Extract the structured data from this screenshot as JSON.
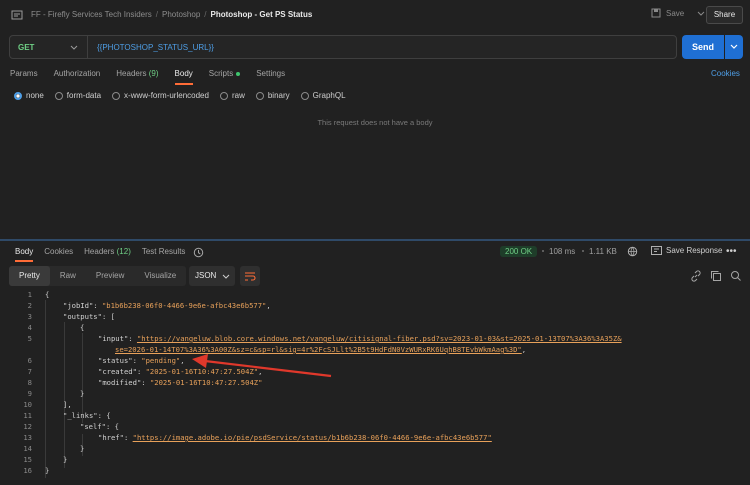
{
  "header": {
    "breadcrumb": [
      "FF - Firefly Services Tech Insiders",
      "Photoshop"
    ],
    "title": "Photoshop - Get PS Status",
    "save_label": "Save",
    "share_label": "Share"
  },
  "request": {
    "method": "GET",
    "url": "{{PHOTOSHOP_STATUS_URL}}",
    "send_label": "Send",
    "tabs": [
      "Params",
      "Authorization",
      "Headers",
      "Body",
      "Scripts",
      "Settings"
    ],
    "headers_count": "(9)",
    "cookies_label": "Cookies",
    "body_types": [
      "none",
      "form-data",
      "x-www-form-urlencoded",
      "raw",
      "binary",
      "GraphQL"
    ],
    "empty_message": "This request does not have a body"
  },
  "response": {
    "tabs": [
      "Body",
      "Cookies",
      "Headers",
      "Test Results"
    ],
    "headers_count": "(12)",
    "status": "200 OK",
    "time": "108 ms",
    "size": "1.11 KB",
    "save_response_label": "Save Response",
    "views": [
      "Pretty",
      "Raw",
      "Preview",
      "Visualize"
    ],
    "format": "JSON",
    "lines": [
      {
        "n": "1",
        "text": "{"
      },
      {
        "n": "2",
        "key": "\"jobId\"",
        "val": "\"b1b6b238-06f0-4466-9e6e-afbc43e6b577\"",
        "tail": ","
      },
      {
        "n": "3",
        "key": "\"outputs\"",
        "tail": "["
      },
      {
        "n": "4",
        "text": "{"
      },
      {
        "n": "5",
        "key": "\"input\"",
        "val": "\"https://vangeluw.blob.core.windows.net/vangeluw/citisignal-fiber.psd?sv=2023-01-03&st=2025-01-13T07%3A36%3A35Z&",
        "val2": "se=2026-01-14T07%3A36%3A00Z&sz=c&sp=rl&sig=4r%2FcSJLlt%2B5t9HdFdN0VzWURxRK6UqhB8TEvbWkmAag%3D\"",
        "tail": ","
      },
      {
        "n": "6",
        "key": "\"status\"",
        "val": "\"pending\"",
        "tail": ","
      },
      {
        "n": "7",
        "key": "\"created\"",
        "val": "\"2025-01-16T10:47:27.504Z\"",
        "tail": ","
      },
      {
        "n": "8",
        "key": "\"modified\"",
        "val": "\"2025-01-16T10:47:27.504Z\""
      },
      {
        "n": "9",
        "text": "}"
      },
      {
        "n": "10",
        "text": "],"
      },
      {
        "n": "11",
        "key": "\"_links\"",
        "tail": "{"
      },
      {
        "n": "12",
        "key": "\"self\"",
        "tail": "{"
      },
      {
        "n": "13",
        "key": "\"href\"",
        "val": "\"https://image.adobe.io/pie/psdService/status/b1b6b238-06f0-4466-9e6e-afbc43e6b577\""
      },
      {
        "n": "14",
        "text": "}"
      },
      {
        "n": "15",
        "text": "}"
      },
      {
        "n": "16",
        "text": "}"
      }
    ]
  },
  "colors": {
    "accent": "#ff6c37",
    "send": "#1f6fd3",
    "string": "#e8a15a",
    "ok": "#6fcf85",
    "annotation_arrow": "#e0382b"
  }
}
